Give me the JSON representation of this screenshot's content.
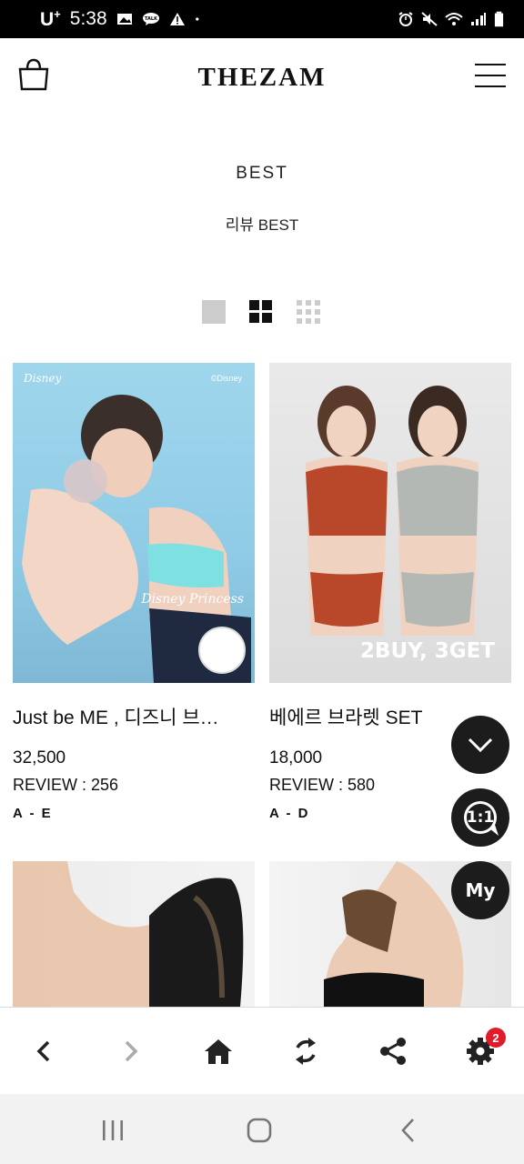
{
  "status_bar": {
    "carrier": "U",
    "carrier_sup": "+",
    "time": "5:38",
    "icons_left": [
      "image-icon",
      "talk-icon",
      "warning-icon",
      "dot-icon"
    ],
    "icons_right": [
      "alarm-icon",
      "mute-icon",
      "wifi-icon",
      "signal-icon",
      "battery-icon"
    ]
  },
  "header": {
    "logo": "THEZAM",
    "cart_icon": "shopping-bag-icon",
    "menu_icon": "hamburger-menu-icon"
  },
  "section": {
    "title": "BEST",
    "subtitle": "리뷰 BEST"
  },
  "view_modes": [
    "single-view-icon",
    "grid-2-view-icon",
    "grid-3-view-icon"
  ],
  "products": [
    {
      "name": "Just be ME , 디즈니 브…",
      "price": "32,500",
      "review": "REVIEW : 256",
      "size": "A - E",
      "image_tag": "Disney Princess"
    },
    {
      "name": "베에르 브라렛 SET",
      "price": "18,000",
      "review": "REVIEW : 580",
      "size": "A - D",
      "image_tag": "2BUY, 3GET"
    },
    {
      "name": "",
      "price": "",
      "review": "",
      "size": "",
      "image_tag": ""
    },
    {
      "name": "",
      "price": "",
      "review": "",
      "size": "",
      "image_tag": ""
    }
  ],
  "floating": {
    "scroll_icon": "chevron-down-icon",
    "chat_label": "1:1",
    "my_label": "My"
  },
  "toolbar": {
    "icons": [
      "back-arrow-icon",
      "forward-arrow-icon",
      "home-icon",
      "refresh-icon",
      "share-icon",
      "settings-icon"
    ],
    "settings_badge": "2"
  },
  "nav": {
    "icons": [
      "recent-apps-icon",
      "home-circle-icon",
      "back-icon"
    ]
  }
}
